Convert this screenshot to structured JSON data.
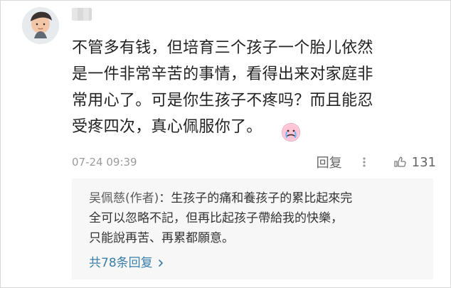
{
  "comment": {
    "username": "",
    "text": "不管多有钱，但培育三个孩子一个胎儿依然\n是一件非常辛苦的事情，看得出来对家庭非\n常用心了。可是你生孩子不疼吗？而且能忍\n受疼四次，真心佩服你了。",
    "timestamp": "07-24 09:39",
    "reply_label": "回复",
    "likes": "131"
  },
  "author_reply": {
    "author": "吴佩慈(作者)",
    "line1": "：生孩子的痛和養孩子的累比起來完",
    "line2": "全可以忽略不記，但再比起孩子帶給我的快樂，",
    "line3": "只能說再苦、再累都願意。"
  },
  "reply_summary": {
    "count_text": "共78条回复"
  },
  "icons": {
    "avatar": "child-avatar",
    "emoji": "crying-emoji",
    "more": "more-dots-icon",
    "like": "thumb-up-icon",
    "chevron": "chevron-right-icon"
  },
  "colors": {
    "link": "#3b7ea8",
    "meta": "#9b9b9b",
    "reply_bg": "#f7f7f7"
  }
}
